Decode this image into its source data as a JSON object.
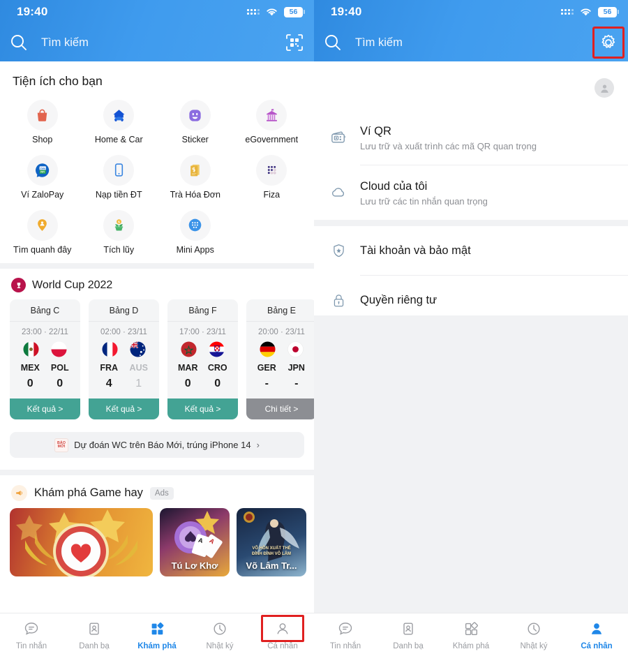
{
  "status": {
    "time": "19:40",
    "battery": "56",
    "signal_icon": "signal-dots-icon",
    "wifi_icon": "wifi-icon",
    "battery_icon": "battery-icon"
  },
  "search": {
    "placeholder": "Tìm kiếm",
    "icon": "search-icon",
    "qr_icon": "qr-scan-icon",
    "settings_icon": "gear-icon"
  },
  "left": {
    "utilities_title": "Tiện ích cho bạn",
    "utilities": [
      {
        "label": "Shop",
        "icon": "shopping-bag-icon",
        "color": "#e2644e"
      },
      {
        "label": "Home & Car",
        "icon": "home-car-icon",
        "color": "#1453d4"
      },
      {
        "label": "Sticker",
        "icon": "smiley-sticker-icon",
        "color": "#8b6ce0"
      },
      {
        "label": "eGovernment",
        "icon": "government-building-icon",
        "color": "#b756c9"
      },
      {
        "label": "Ví ZaloPay",
        "icon": "zalopay-icon",
        "color": "#0f63c4"
      },
      {
        "label": "Nạp tiền ĐT",
        "icon": "mobile-topup-icon",
        "color": "#3b86e0"
      },
      {
        "label": "Trà Hóa Đơn",
        "icon": "invoice-bill-icon",
        "color": "#e8b43c"
      },
      {
        "label": "Fiza",
        "icon": "fiza-dots-icon",
        "color": "#3b2e7e"
      },
      {
        "label": "Tìm quanh đây",
        "icon": "location-pin-person-icon",
        "color": "#f0ab2e"
      },
      {
        "label": "Tích lũy",
        "icon": "money-plant-icon",
        "color": "#49b36a"
      },
      {
        "label": "Mini Apps",
        "icon": "mini-apps-grid-icon",
        "color": "#3b93e8"
      }
    ],
    "worldcup": {
      "title": "World Cup 2022",
      "badge_icon": "trophy-icon",
      "matches": [
        {
          "group": "Bảng C",
          "time": "23:00 · 22/11",
          "home": {
            "code": "MEX",
            "score": "0",
            "flag": "mexico-flag-icon",
            "dim": false
          },
          "away": {
            "code": "POL",
            "score": "0",
            "flag": "poland-flag-icon",
            "dim": false
          },
          "button": "Kết quả >",
          "button_style": "teal"
        },
        {
          "group": "Bảng D",
          "time": "02:00 · 23/11",
          "home": {
            "code": "FRA",
            "score": "4",
            "flag": "france-flag-icon",
            "dim": false
          },
          "away": {
            "code": "AUS",
            "score": "1",
            "flag": "australia-flag-icon",
            "dim": true
          },
          "button": "Kết quả >",
          "button_style": "teal"
        },
        {
          "group": "Bảng F",
          "time": "17:00 · 23/11",
          "home": {
            "code": "MAR",
            "score": "0",
            "flag": "morocco-flag-icon",
            "dim": false
          },
          "away": {
            "code": "CRO",
            "score": "0",
            "flag": "croatia-flag-icon",
            "dim": false
          },
          "button": "Kết quả >",
          "button_style": "teal"
        },
        {
          "group": "Bảng E",
          "time": "20:00 · 23/11",
          "home": {
            "code": "GER",
            "score": "-",
            "flag": "germany-flag-icon",
            "dim": false
          },
          "away": {
            "code": "JPN",
            "score": "-",
            "flag": "japan-flag-icon",
            "dim": false
          },
          "button": "Chi tiết >",
          "button_style": "grey"
        }
      ]
    },
    "promo": {
      "logo_line1": "BÁO",
      "logo_line2": "MỚI",
      "text": "Dự đoán WC trên Báo Mới, trúng iPhone 14",
      "chevron": "›"
    },
    "games": {
      "title": "Khám phá Game hay",
      "badge_icon": "megaphone-icon",
      "ads_label": "Ads",
      "cards": [
        {
          "caption": "",
          "art": "casino-chip-heart-art"
        },
        {
          "caption": "Tú Lơ Khơ",
          "art": "poker-cards-art"
        },
        {
          "caption": "Võ Lâm Tr...",
          "art": "martial-hero-art",
          "sub1": "VÕ HỒN XUẤT THẾ",
          "sub2": "ĐỈNH ĐỈNH VÕ LÂM"
        }
      ]
    }
  },
  "right": {
    "avatar_icon": "person-avatar-icon",
    "groups": [
      {
        "items": [
          {
            "title": "Ví QR",
            "sub": "Lưu trữ và xuất trình các mã QR quan trọng",
            "icon": "qr-wallet-icon"
          },
          {
            "title": "Cloud của tôi",
            "sub": "Lưu trữ các tin nhắn quan trọng",
            "icon": "cloud-icon"
          }
        ]
      },
      {
        "items": [
          {
            "title": "Tài khoản và bảo mật",
            "sub": "",
            "icon": "shield-star-icon"
          },
          {
            "title": "Quyền riêng tư",
            "sub": "",
            "icon": "lock-icon"
          }
        ]
      }
    ]
  },
  "tabbar": {
    "items": [
      {
        "label": "Tin nhắn",
        "icon": "chat-bubble-icon"
      },
      {
        "label": "Danh bạ",
        "icon": "contacts-icon"
      },
      {
        "label": "Khám phá",
        "icon": "discover-grid-icon"
      },
      {
        "label": "Nhật ký",
        "icon": "clock-timeline-icon"
      },
      {
        "label": "Cá nhân",
        "icon": "person-icon"
      }
    ],
    "left_active_index": 2,
    "left_highlight_index": 4,
    "right_active_index": 4
  },
  "colors": {
    "header_blue": "#3f9bee",
    "accent_blue": "#1f87e8",
    "teal_button": "#43a394",
    "grey_button": "#8c8e93",
    "highlight_red": "#e02020"
  }
}
